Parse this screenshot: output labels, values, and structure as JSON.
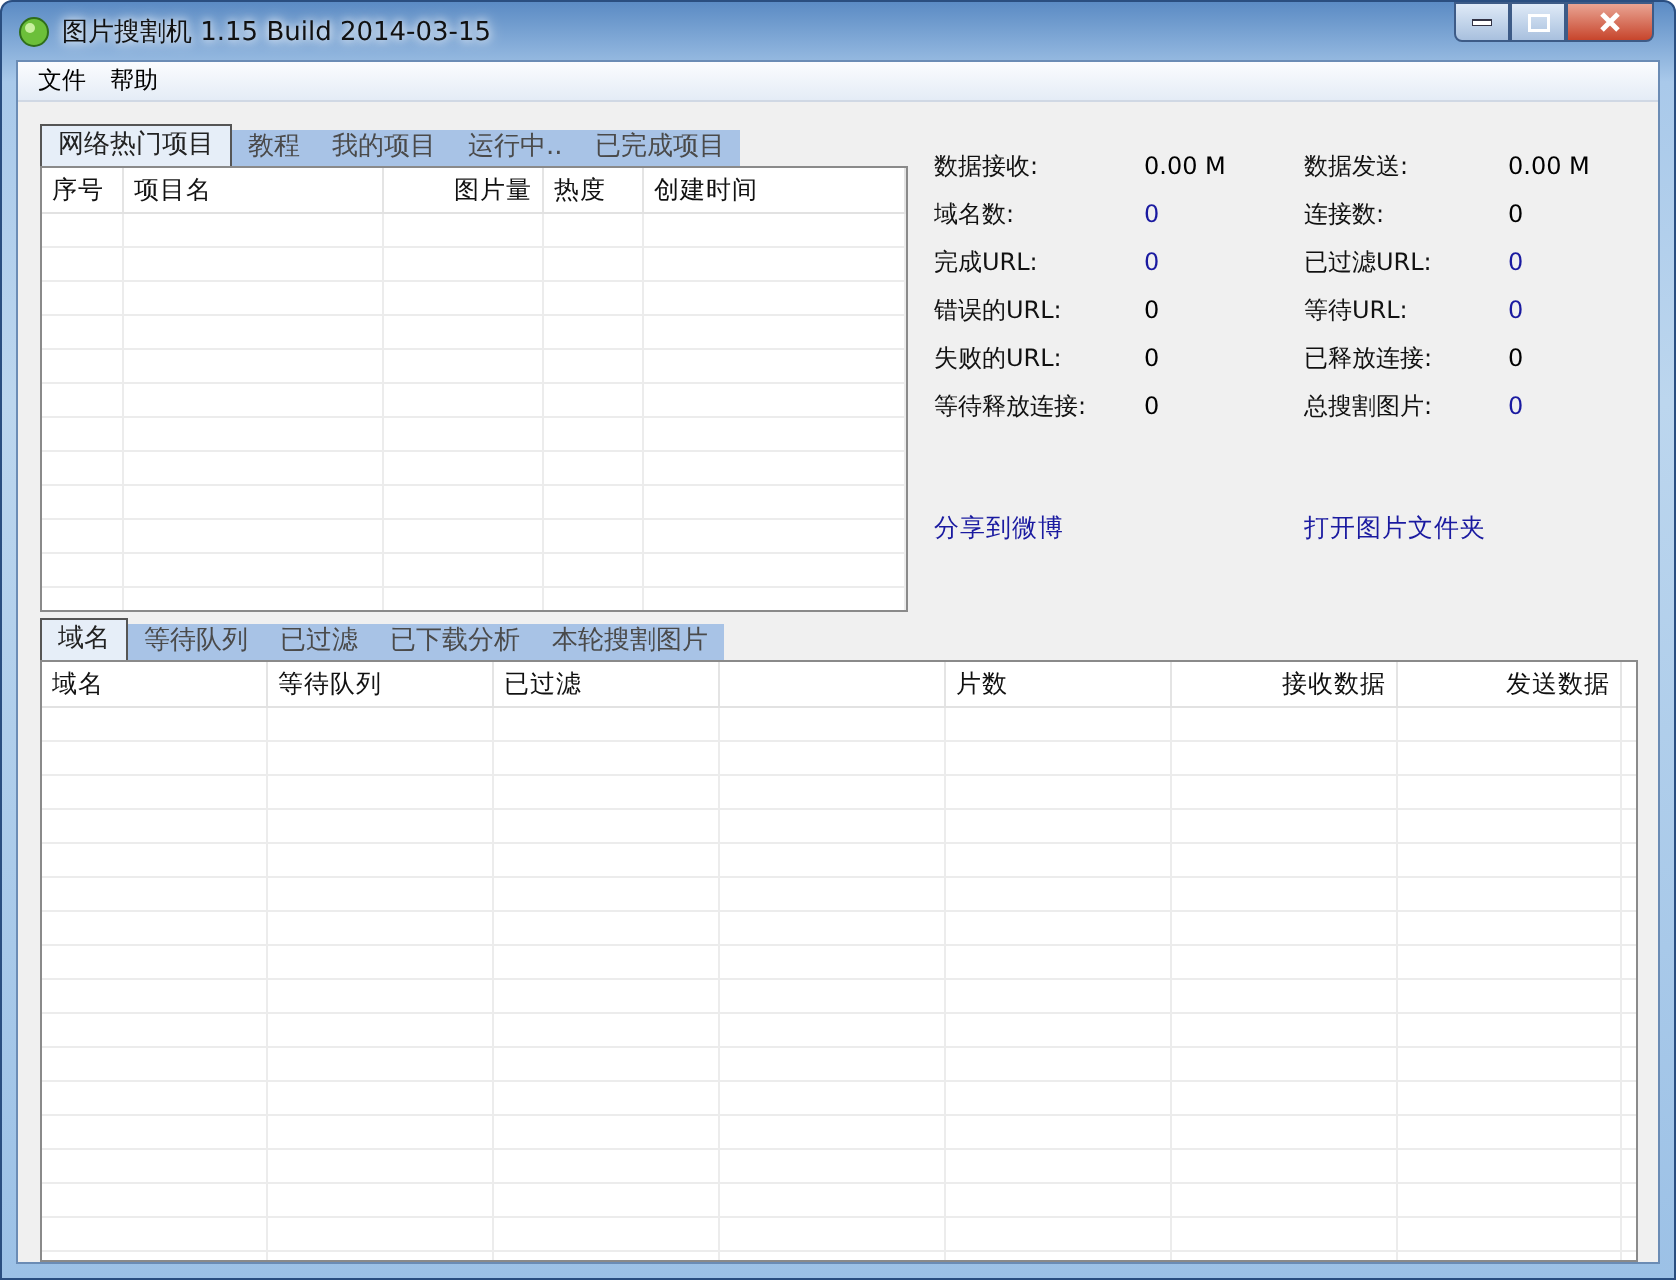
{
  "window": {
    "title": "图片搜割机 1.15 Build 2014-03-15"
  },
  "menu": [
    {
      "label": "文件"
    },
    {
      "label": "帮助"
    }
  ],
  "project_tabs": [
    {
      "label": "网络热门项目",
      "selected": true
    },
    {
      "label": "教程",
      "selected": false
    },
    {
      "label": "我的项目",
      "selected": false
    },
    {
      "label": "运行中..",
      "selected": false
    },
    {
      "label": "已完成项目",
      "selected": false
    }
  ],
  "project_table": {
    "columns": [
      "序号",
      "项目名",
      "图片量",
      "热度",
      "创建时间"
    ]
  },
  "stats": [
    {
      "label": "数据接收:",
      "value": "0.00 M",
      "color": "#000000"
    },
    {
      "label": "数据发送:",
      "value": "0.00 M",
      "color": "#000000"
    },
    {
      "label": "域名数:",
      "value": "0",
      "color": "#1a1aa0"
    },
    {
      "label": "连接数:",
      "value": "0",
      "color": "#000000"
    },
    {
      "label": "完成URL:",
      "value": "0",
      "color": "#1a1aa0"
    },
    {
      "label": "已过滤URL:",
      "value": "0",
      "color": "#1a1aa0"
    },
    {
      "label": "错误的URL:",
      "value": "0",
      "color": "#000000"
    },
    {
      "label": "等待URL:",
      "value": "0",
      "color": "#1a1aa0"
    },
    {
      "label": "失败的URL:",
      "value": "0",
      "color": "#000000"
    },
    {
      "label": "已释放连接:",
      "value": "0",
      "color": "#000000"
    },
    {
      "label": "等待释放连接:",
      "value": "0",
      "color": "#000000"
    },
    {
      "label": "总搜割图片:",
      "value": "0",
      "color": "#1a1aa0"
    }
  ],
  "links": [
    {
      "label": "分享到微博"
    },
    {
      "label": "打开图片文件夹"
    }
  ],
  "domain_tabs": [
    {
      "label": "域名",
      "selected": true
    },
    {
      "label": "等待队列",
      "selected": false
    },
    {
      "label": "已过滤",
      "selected": false
    },
    {
      "label": "已下载分析",
      "selected": false
    },
    {
      "label": "本轮搜割图片",
      "selected": false
    }
  ],
  "domain_table": {
    "columns": [
      {
        "label": "域名"
      },
      {
        "label": "等待队列"
      },
      {
        "label": "已过滤"
      },
      {},
      {
        "label": "片数"
      },
      {
        "label": "接收数据"
      },
      {
        "label": "发送数据"
      }
    ]
  }
}
